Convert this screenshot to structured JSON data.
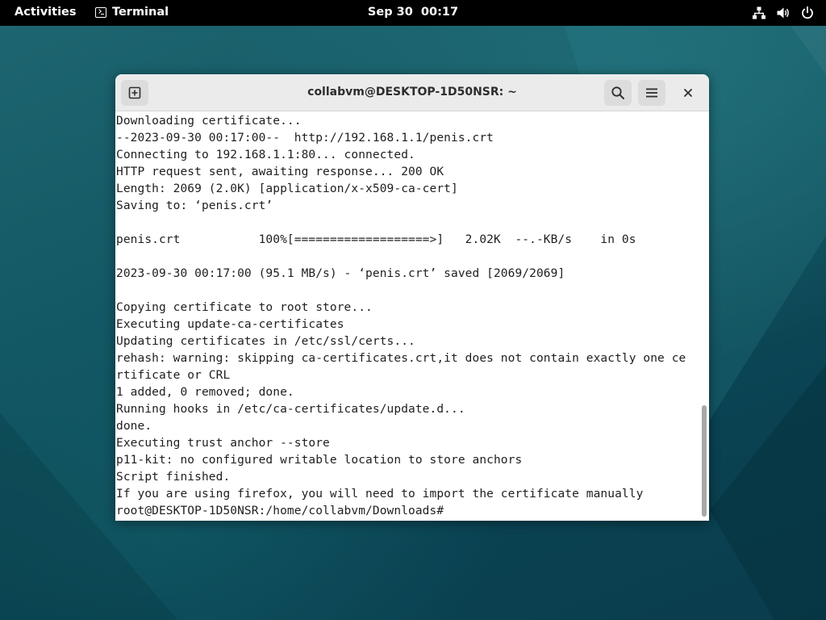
{
  "topbar": {
    "activities_label": "Activities",
    "app_name": "Terminal",
    "clock_date": "Sep 30",
    "clock_time": "00:17",
    "tray_icons": [
      "network-icon",
      "volume-icon",
      "power-icon"
    ]
  },
  "window": {
    "title": "collabvm@DESKTOP-1D50NSR: ~",
    "buttons": {
      "new_tab": "new-tab-icon",
      "search": "search-icon",
      "menu": "hamburger-menu-icon",
      "close": "close-icon"
    }
  },
  "terminal": {
    "lines": [
      "Downloading certificate...",
      "--2023-09-30 00:17:00--  http://192.168.1.1/penis.crt",
      "Connecting to 192.168.1.1:80... connected.",
      "HTTP request sent, awaiting response... 200 OK",
      "Length: 2069 (2.0K) [application/x-x509-ca-cert]",
      "Saving to: ‘penis.crt’",
      "",
      "penis.crt           100%[===================>]   2.02K  --.-KB/s    in 0s",
      "",
      "2023-09-30 00:17:00 (95.1 MB/s) - ‘penis.crt’ saved [2069/2069]",
      "",
      "Copying certificate to root store...",
      "Executing update-ca-certificates",
      "Updating certificates in /etc/ssl/certs...",
      "rehash: warning: skipping ca-certificates.crt,it does not contain exactly one ce",
      "rtificate or CRL",
      "1 added, 0 removed; done.",
      "Running hooks in /etc/ca-certificates/update.d...",
      "done.",
      "Executing trust anchor --store",
      "p11-kit: no configured writable location to store anchors",
      "Script finished.",
      "If you are using firefox, you will need to import the certificate manually",
      "root@DESKTOP-1D50NSR:/home/collabvm/Downloads#"
    ]
  },
  "colors": {
    "topbar_bg": "#000000",
    "headerbar_bg": "#ebebeb",
    "terminal_bg": "#ffffff",
    "terminal_fg": "#1e1e1e",
    "wallpaper": "#0f4c5c"
  }
}
